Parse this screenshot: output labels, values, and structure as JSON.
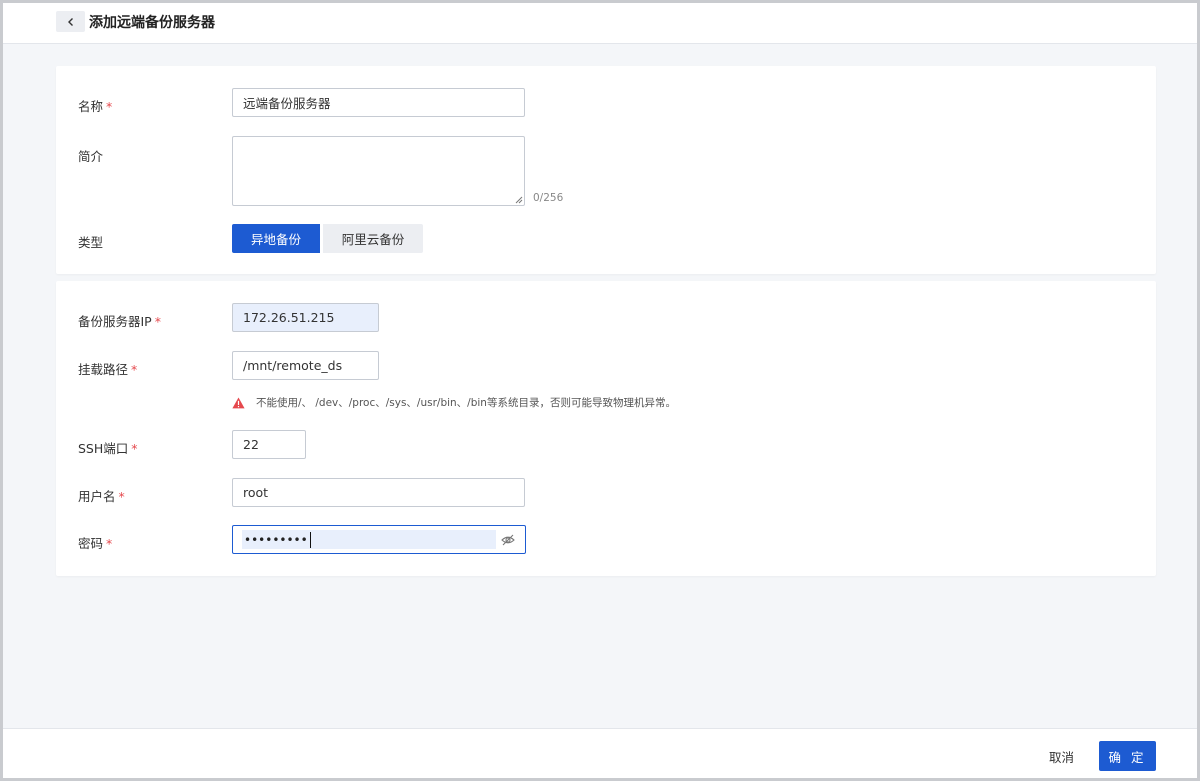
{
  "header": {
    "title": "添加远端备份服务器"
  },
  "section1": {
    "name": {
      "label": "名称",
      "required": "*",
      "value": "远端备份服务器"
    },
    "description": {
      "label": "简介",
      "counter": "0/256"
    },
    "type": {
      "label": "类型",
      "options": [
        "异地备份",
        "阿里云备份"
      ],
      "selected": "异地备份"
    }
  },
  "section2": {
    "server_ip": {
      "label": "备份服务器IP",
      "required": "*",
      "value": "172.26.51.215"
    },
    "mount_path": {
      "label": "挂载路径",
      "required": "*",
      "value": "/mnt/remote_ds",
      "warning": "不能使用/、 /dev、/proc、/sys、/usr/bin、/bin等系统目录，否则可能导致物理机异常。"
    },
    "ssh_port": {
      "label": "SSH端口",
      "required": "*",
      "value": "22"
    },
    "username": {
      "label": "用户名",
      "required": "*",
      "value": "root"
    },
    "password": {
      "label": "密码",
      "required": "*",
      "value": "•••••••••"
    }
  },
  "footer": {
    "cancel": "取消",
    "confirm": "确 定"
  },
  "colors": {
    "primary": "#1d5bd2",
    "required": "#e5484d",
    "warning": "#e5484d"
  }
}
